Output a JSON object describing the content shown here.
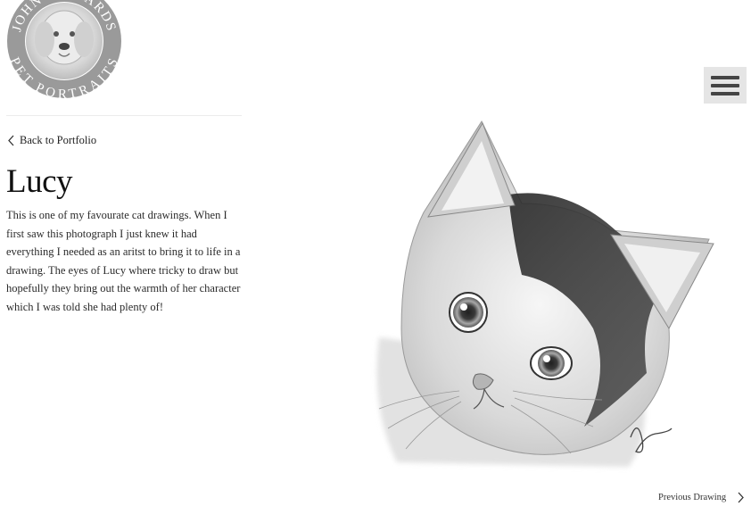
{
  "logo": {
    "arc_top": "JOHN RICHARDS",
    "arc_bottom": "PET PORTRAITS"
  },
  "nav": {
    "back_label": "Back to Portfolio",
    "menu_icon": "hamburger-menu-icon"
  },
  "artwork": {
    "title": "Lucy",
    "description": "This is one of my favourate cat drawings. When I first saw this photograph I just knew it had everything I needed as an aritst to bring it to life in a drawing. The eyes of Lucy where tricky to draw but hopefully they bring out the warmth of her character which I was told she had plenty of!",
    "image_icon": "cat-drawing-image"
  },
  "pagination": {
    "previous_label": "Previous Drawing"
  },
  "colors": {
    "logo_grey": "#8f8f8f",
    "menu_bg": "#e5e5e5",
    "menu_bars": "#444444",
    "text": "#1a1a1a"
  }
}
